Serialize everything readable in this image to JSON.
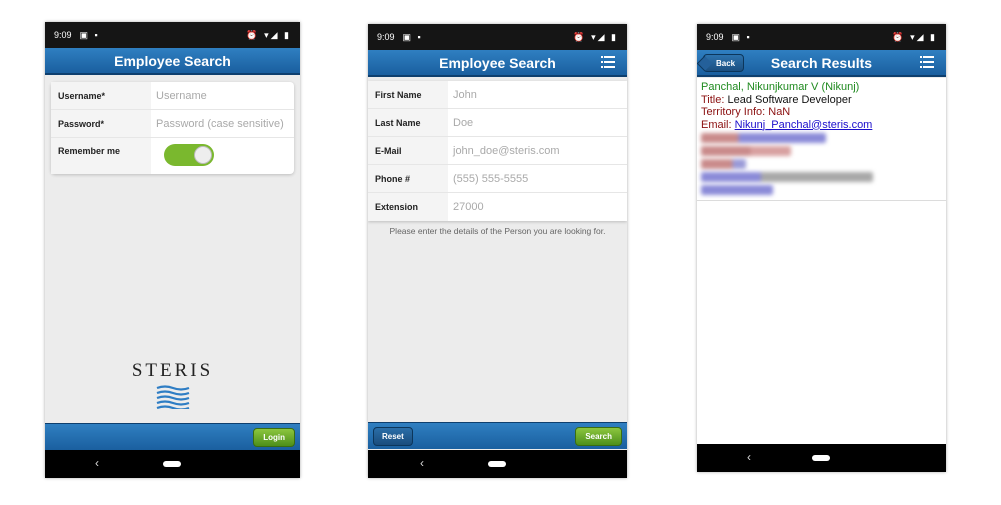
{
  "status_time": "9:09",
  "screen1": {
    "title": "Employee Search",
    "fields": [
      {
        "label": "Username*",
        "placeholder": "Username"
      },
      {
        "label": "Password*",
        "placeholder": "Password (case sensitive)"
      }
    ],
    "remember_label": "Remember me",
    "remember_on": true,
    "logo_text": "STERIS",
    "login_label": "Login"
  },
  "screen2": {
    "title": "Employee Search",
    "fields": [
      {
        "label": "First Name",
        "placeholder": "John"
      },
      {
        "label": "Last Name",
        "placeholder": "Doe"
      },
      {
        "label": "E-Mail",
        "placeholder": "john_doe@steris.com"
      },
      {
        "label": "Phone #",
        "placeholder": "(555) 555-5555"
      },
      {
        "label": "Extension",
        "placeholder": "27000"
      }
    ],
    "hint": "Please enter the details of the Person you are looking for.",
    "reset_label": "Reset",
    "search_label": "Search"
  },
  "screen3": {
    "title": "Search Results",
    "back_label": "Back",
    "result": {
      "name": "Panchal, Nikunjkumar V (Nikunj)",
      "title_key": "Title:",
      "title_val": "Lead Software Developer",
      "territory_key": "Territory Info:",
      "territory_val": "NaN",
      "email_key": "Email:",
      "email_val": "Nikunj_Panchal@steris.com"
    }
  },
  "colors": {
    "header_blue": "#1f6aae",
    "button_green": "#6aa82a",
    "name_green": "#1f8a1f",
    "key_red": "#8b1010"
  }
}
